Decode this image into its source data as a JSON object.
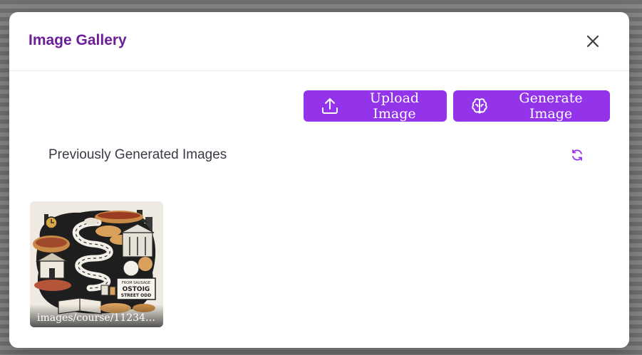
{
  "dialog": {
    "title": "Image Gallery",
    "close_icon": "close-icon"
  },
  "toolbar": {
    "upload_label": "Upload Image",
    "upload_icon": "upload-icon",
    "generate_label": "Generate Image",
    "generate_icon": "brain-icon"
  },
  "gallery": {
    "section_label": "Previously Generated Images",
    "refresh_icon": "refresh-icon",
    "images": [
      {
        "caption": "images/course/11234/1...",
        "sign_lines": [
          "FROM SAUSAGE",
          "OSTOIG",
          "STREET ODD"
        ]
      }
    ]
  },
  "colors": {
    "title": "#6b1e9b",
    "button": "#9333ea",
    "icon_accent": "#9333ea"
  }
}
